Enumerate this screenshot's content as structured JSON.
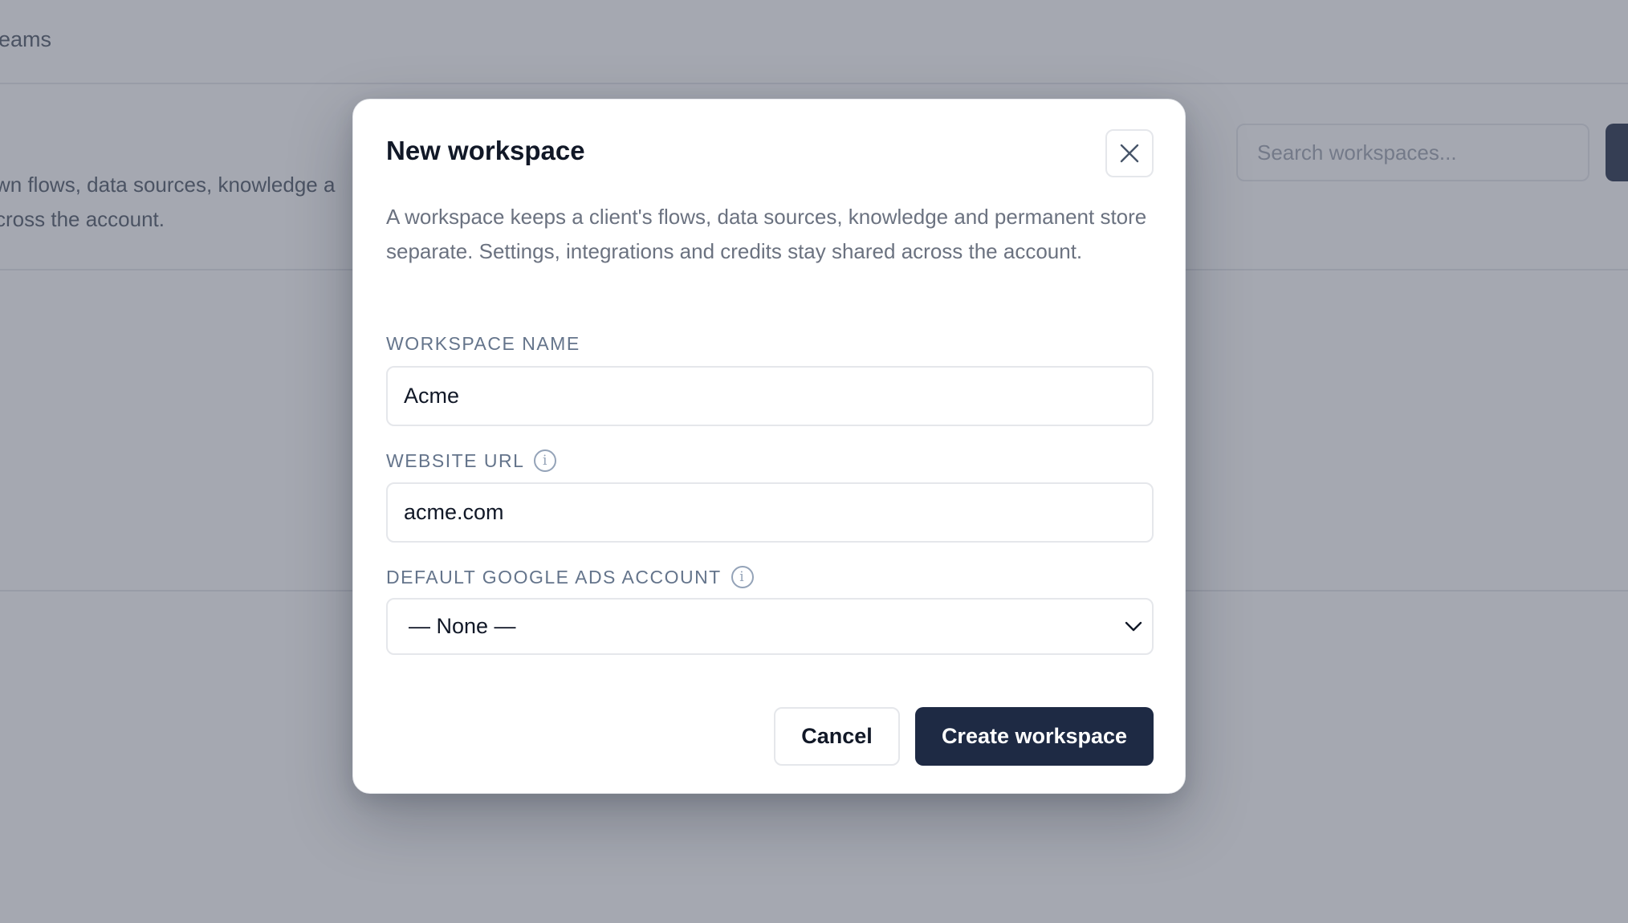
{
  "background": {
    "breadcrumb": "eams",
    "description": "wn flows, data sources, knowledge a\ncross the account.",
    "search_placeholder": "Search workspaces..."
  },
  "modal": {
    "title": "New workspace",
    "close_icon": "close-icon",
    "description": "A workspace keeps a client's flows, data sources, knowledge and permanent store separate. Settings, integrations and credits stay shared across the account.",
    "fields": {
      "workspace_name": {
        "label": "WORKSPACE NAME",
        "value": "Acme"
      },
      "website_url": {
        "label": "WEBSITE URL",
        "value": "acme.com",
        "info_icon": "info-icon"
      },
      "google_ads_account": {
        "label": "DEFAULT GOOGLE ADS ACCOUNT",
        "value": "— None —",
        "info_icon": "info-icon"
      }
    },
    "buttons": {
      "cancel": "Cancel",
      "create": "Create workspace"
    }
  },
  "colors": {
    "primary": "#1e2a44",
    "overlay": "rgba(75,82,99,0.5)",
    "muted_text": "#6b7280"
  }
}
